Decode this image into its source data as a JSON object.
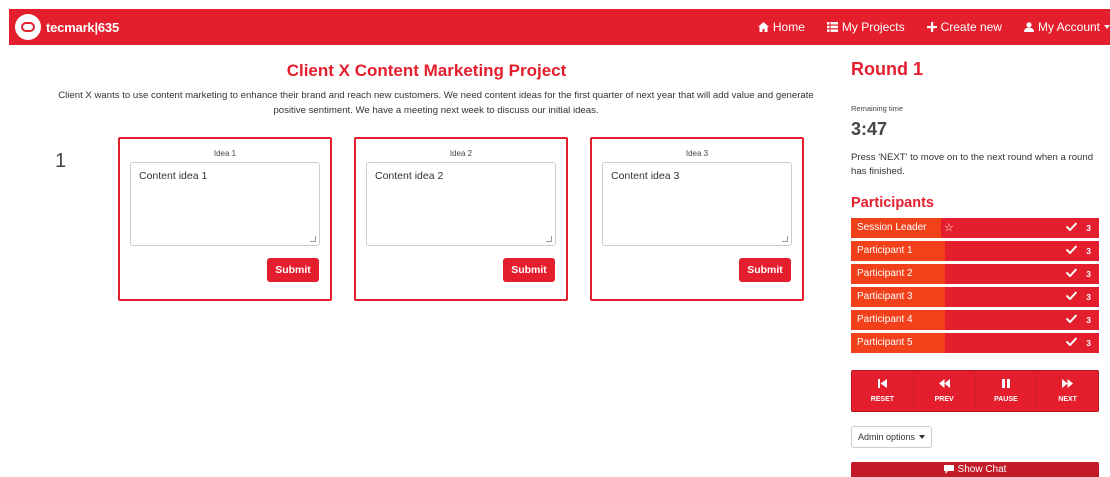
{
  "brand": {
    "name": "tecmark|635"
  },
  "nav": {
    "home": "Home",
    "my_projects": "My Projects",
    "create_new": "Create new",
    "my_account": "My Account"
  },
  "project": {
    "title": "Client X Content Marketing Project",
    "description": "Client X wants to use content marketing to enhance their brand and reach new customers. We need content ideas for the first quarter of next year that will add value and generate positive sentiment. We have a meeting next week to discuss our initial ideas.",
    "row_number": "1",
    "ideas": [
      {
        "label": "Idea 1",
        "value": "Content idea 1",
        "submit": "Submit"
      },
      {
        "label": "Idea 2",
        "value": "Content idea 2",
        "submit": "Submit"
      },
      {
        "label": "Idea 3",
        "value": "Content idea 3",
        "submit": "Submit"
      }
    ]
  },
  "sidebar": {
    "round_title": "Round 1",
    "remaining_label": "Remaining time",
    "timer": "3:47",
    "instructions": "Press 'NEXT' to move on to the next round when a round has finished.",
    "participants_title": "Participants",
    "participants": [
      {
        "name": "Session Leader",
        "count": "3",
        "leader": true
      },
      {
        "name": "Participant 1",
        "count": "3"
      },
      {
        "name": "Participant 2",
        "count": "3"
      },
      {
        "name": "Participant 3",
        "count": "3"
      },
      {
        "name": "Participant 4",
        "count": "3"
      },
      {
        "name": "Participant 5",
        "count": "3"
      }
    ],
    "controls": {
      "reset": "RESET",
      "prev": "PREV",
      "pause": "PAUSE",
      "next": "NEXT"
    },
    "admin_options": "Admin options",
    "show_chat": "Show Chat"
  },
  "colors": {
    "accent": "#e41e2c",
    "participant_name_bg": "#f2411a"
  },
  "icons": {
    "home": "home-icon",
    "projects": "list-icon",
    "create": "plus-icon",
    "account": "user-icon",
    "leader": "star-icon",
    "done": "check-icon",
    "reset": "skip-back-icon",
    "prev": "rewind-icon",
    "pause": "pause-icon",
    "next": "fast-forward-icon",
    "chat": "chat-icon"
  }
}
